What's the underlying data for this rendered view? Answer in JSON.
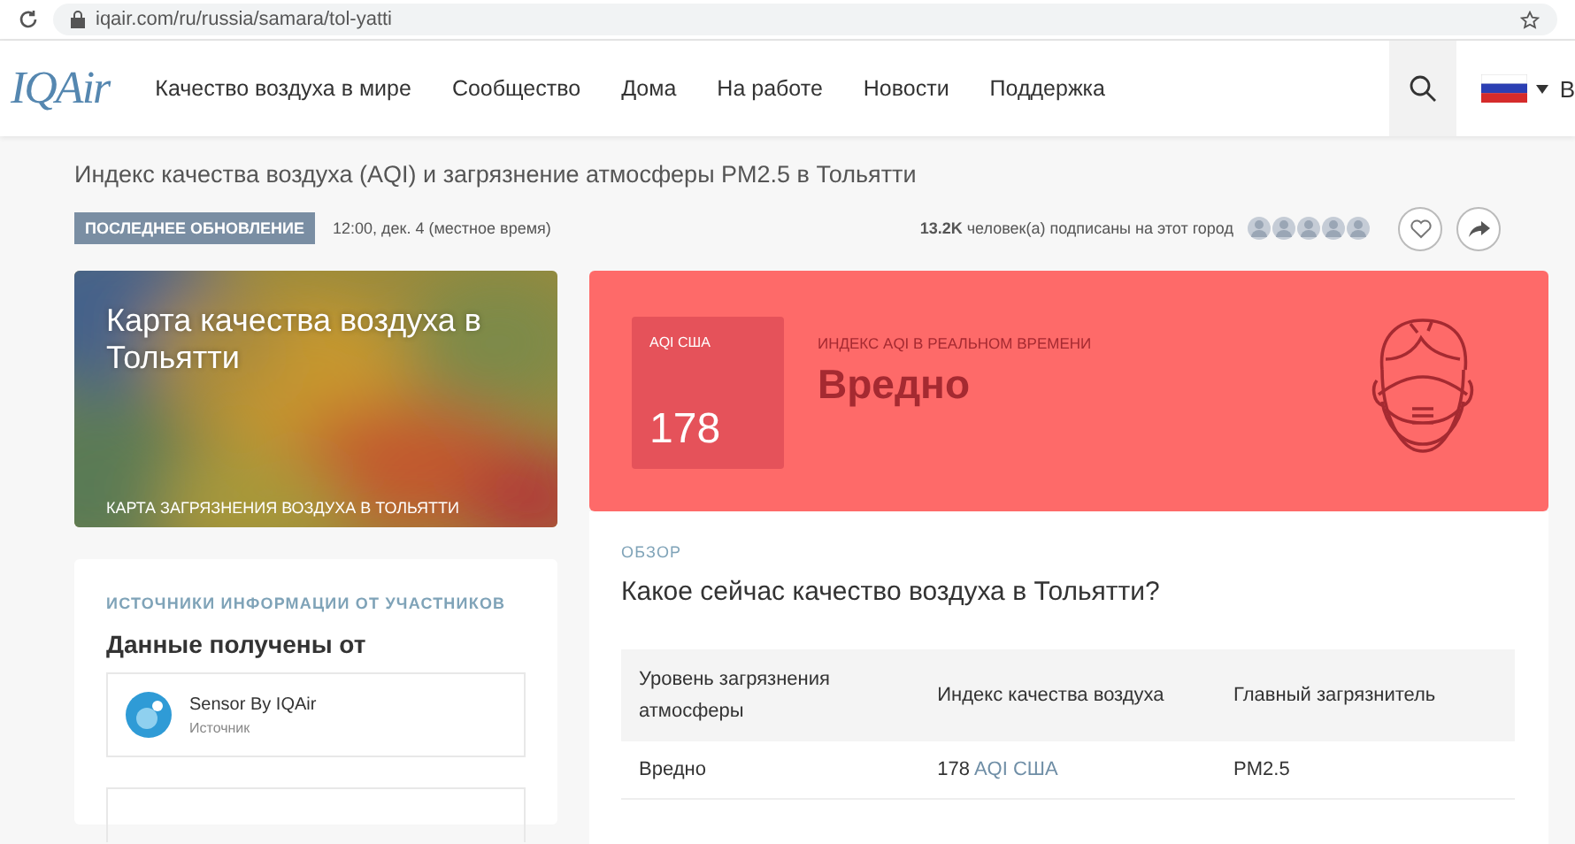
{
  "browser": {
    "url": "iqair.com/ru/russia/samara/tol-yatti"
  },
  "nav": {
    "logo": "IQAir",
    "items": [
      "Качество воздуха в мире",
      "Сообщество",
      "Дома",
      "На работе",
      "Новости",
      "Поддержка"
    ],
    "login_cut": "В"
  },
  "header": {
    "subtitle": "Индекс качества воздуха (AQI) и загрязнение атмосферы PM2.5 в Тольятти",
    "update_badge": "ПОСЛЕДНЕЕ ОБНОВЛЕНИЕ",
    "update_time": "12:00, дек. 4 (местное время)",
    "followers": "**13.2K** человек(а) подписаны на этот город"
  },
  "map_card": {
    "title": "Карта качества воздуха в Тольятти",
    "caption": "КАРТА ЗАГРЯЗНЕНИЯ ВОЗДУХА В ТОЛЬЯТТИ"
  },
  "sources": {
    "heading": "ИСТОЧНИКИ ИНФОРМАЦИИ ОТ УЧАСТНИКОВ",
    "title": "Данные получены от",
    "items": [
      {
        "name": "Sensor By IQAir",
        "type": "Источник"
      }
    ]
  },
  "aqi_card": {
    "color": "#fe6a69",
    "badge_label": "AQI США",
    "value": "178",
    "realtime_label": "ИНДЕКС AQI В РЕАЛЬНОМ ВРЕМЕНИ",
    "status": "Вредно"
  },
  "overview": {
    "label": "ОБЗОР",
    "question": "Какое сейчас качество воздуха в Тольятти?",
    "table": {
      "columns": [
        "Уровень загрязнения атмосферы",
        "Индекс качества воздуха",
        "Главный загрязнитель"
      ],
      "rows": [
        {
          "level": "Вредно",
          "aqi": "178",
          "aqi_unit": "AQI США",
          "pollutant": "PM2.5"
        }
      ]
    }
  }
}
